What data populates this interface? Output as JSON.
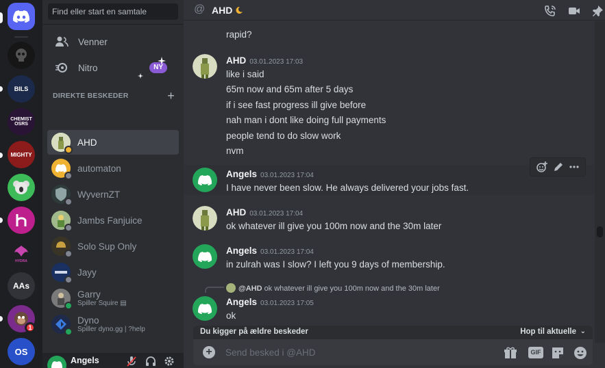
{
  "sidebar": {
    "search_placeholder": "Find eller start en samtale",
    "nav": [
      {
        "label": "Venner",
        "icon": "friends-icon"
      },
      {
        "label": "Nitro",
        "icon": "nitro-icon",
        "badge": "NY"
      }
    ],
    "dm_header": "DIREKTE BESKEDER",
    "dms": [
      {
        "name": "AHD",
        "status": "idle",
        "active": true
      },
      {
        "name": "automaton",
        "status": "offline"
      },
      {
        "name": "WyvernZT",
        "status": "offline"
      },
      {
        "name": "Jambs Fanjuice",
        "status": "offline"
      },
      {
        "name": "Solo Sup Only",
        "status": "offline"
      },
      {
        "name": "Jayy",
        "status": "offline"
      },
      {
        "name": "Garry",
        "sub": "Spiller Squire",
        "status": "online"
      },
      {
        "name": "Dyno",
        "sub": "Spiller dyno.gg | ?help",
        "status": "online"
      }
    ],
    "user": {
      "name": "Angels"
    }
  },
  "servers": [
    {
      "label": "",
      "color": "#161616"
    },
    {
      "label": "BILS",
      "color": "#1b2a4a"
    },
    {
      "label": "CHEMIST OSRS",
      "color": "#2a1436"
    },
    {
      "label": "MIGHTY",
      "color": "#8c1c1c"
    },
    {
      "label": "",
      "color": "#3dbb59"
    },
    {
      "label": "",
      "color": "#bd1f8c"
    },
    {
      "label": "HYDRA",
      "color": "#1e1f22"
    },
    {
      "label": "AAs",
      "color": "#313338"
    },
    {
      "label": "",
      "color": "#7a2b8c",
      "badge": "1"
    },
    {
      "label": "OS",
      "color": "#2850c8"
    }
  ],
  "chat": {
    "title": "AHD",
    "header_icons": [
      "call-icon",
      "video-icon",
      "pin-icon"
    ],
    "top_partial_line": "rapid?",
    "groups": [
      {
        "author": "AHD",
        "time": "03.01.2023 17:03",
        "lines": [
          "like i said",
          "65m now and 65m after 5 days",
          "if i see fast progress ill give before",
          "nah man i dont like doing full payments",
          "people tend to do slow work",
          "nvm"
        ]
      },
      {
        "author": "Angels",
        "time": "03.01.2023 17:04",
        "lines": [
          "I have never been slow. He always delivered your jobs fast."
        ]
      },
      {
        "author": "AHD",
        "time": "03.01.2023 17:04",
        "lines": [
          "ok whatever ill give you 100m now and the 30m later"
        ]
      },
      {
        "author": "Angels",
        "time": "03.01.2023 17:04",
        "lines": [
          "in zulrah was I slow? I left you 9 days of membership."
        ]
      },
      {
        "author": "Angels",
        "time": "03.01.2023 17:05",
        "lines": [
          "ok"
        ],
        "reply": {
          "name": "@AHD",
          "text": "ok whatever ill give you 100m now and the 30m later"
        }
      }
    ],
    "older_banner": "Du kigger på ældre beskeder",
    "jump_label": "Hop til aktuelle",
    "composer_placeholder": "Send besked i @AHD",
    "gif_label": "GIF"
  }
}
